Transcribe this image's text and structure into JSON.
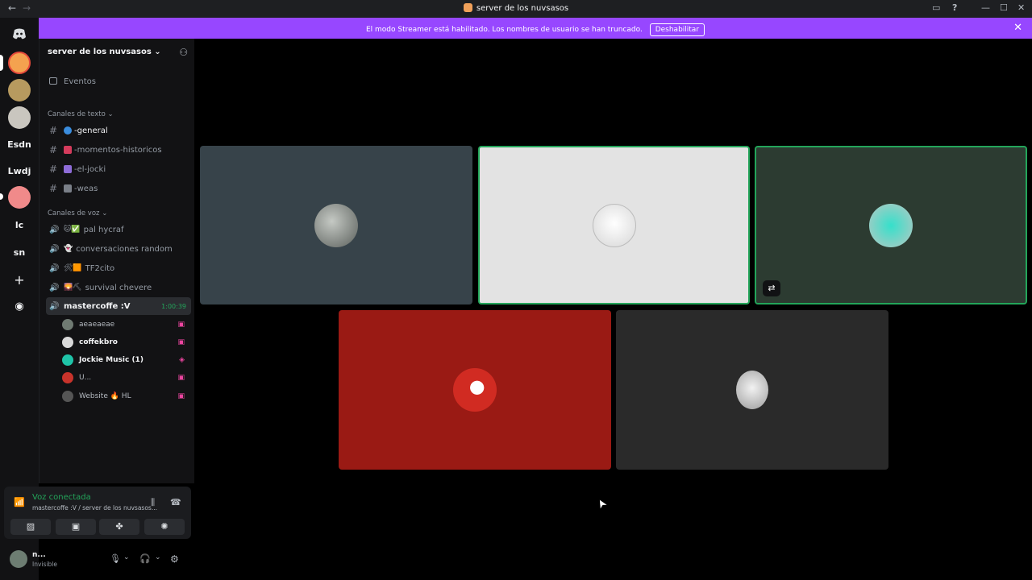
{
  "window": {
    "title": "server de los nuvsasos",
    "back_glyph": "←",
    "forward_glyph": "→",
    "inbox_glyph": "▭",
    "help_glyph": "?",
    "minimize_glyph": "—",
    "maximize_glyph": "☐",
    "close_glyph": "✕"
  },
  "banner": {
    "message": "El modo Streamer está habilitado. Los nombres de usuario se han truncado.",
    "button_label": "Deshabilitar",
    "close_glyph": "✕"
  },
  "server_rail": {
    "items": [
      {
        "name": "discord-home",
        "label": "",
        "icon": "discord-icon"
      },
      {
        "name": "server-1",
        "label": "",
        "icon": "apple-server-icon"
      },
      {
        "name": "server-2",
        "label": "",
        "icon": "dog-server-icon"
      },
      {
        "name": "server-3",
        "label": "",
        "icon": "wolf-server-icon"
      },
      {
        "name": "server-esdn",
        "label": "Esdn"
      },
      {
        "name": "server-lwdj",
        "label": "Lwdj"
      },
      {
        "name": "server-cat",
        "label": "",
        "icon": "cat-server-icon"
      },
      {
        "name": "server-lc",
        "label": "lc"
      },
      {
        "name": "server-sn",
        "label": "sn"
      },
      {
        "name": "add-server",
        "label": "+"
      },
      {
        "name": "discover",
        "label": "◉"
      }
    ]
  },
  "sidebar": {
    "server_name": "server de los nuvsasos",
    "chevron": "⌄",
    "invite_glyph": "⚇",
    "events_label": "Eventos",
    "text_category": "Canales de texto",
    "voice_category": "Canales de voz",
    "hash_glyph": "#",
    "speaker_glyph": "🔊",
    "text_channels": [
      {
        "label": "-general",
        "emoji_color": "#3a8dde",
        "active": true
      },
      {
        "label": "-momentos-historicos",
        "emoji_color": "#d43b5c",
        "active": false
      },
      {
        "label": "-el-jocki",
        "emoji_color": "#8e6cd8",
        "active": false
      },
      {
        "label": "-weas",
        "emoji_color": "#7a7f88",
        "active": false
      }
    ],
    "voice_channels": [
      {
        "label": "pal hycraf",
        "emoji": "🐱✅"
      },
      {
        "label": "conversaciones random",
        "emoji": "👻"
      },
      {
        "label": "TF2cito",
        "emoji": "🛠🟧"
      },
      {
        "label": "survival chevere",
        "emoji": "🌄⛏"
      }
    ],
    "connected_channel": {
      "label": "mastercoffe :V",
      "timer": "1:00:39"
    },
    "members": [
      {
        "name": "aeaeaeae",
        "avatar_color": "#6f7a72",
        "bold": false,
        "live_glyph": "▣"
      },
      {
        "name": "coffekbro",
        "avatar_color": "#d9d9d9",
        "bold": true,
        "live_glyph": "▣"
      },
      {
        "name": "Jockie Music (1)",
        "avatar_color": "#1fc4a8",
        "bold": true,
        "live_glyph": "◈"
      },
      {
        "name": "U...",
        "avatar_color": "#c8332b",
        "bold": false,
        "live_glyph": "▣"
      },
      {
        "name": "Website 🔥 HL",
        "avatar_color": "#555",
        "bold": false,
        "live_glyph": "▣"
      }
    ]
  },
  "voice_panel": {
    "status": "Voz conectada",
    "subtitle": "mastercoffe :V / server de los nuvsasos...",
    "signal_glyph": "📶",
    "noise_glyph": "⫼",
    "disconnect_glyph": "☎",
    "actions": [
      {
        "name": "camera-off-button",
        "glyph": "▨"
      },
      {
        "name": "share-screen-button",
        "glyph": "▣"
      },
      {
        "name": "activities-button",
        "glyph": "✤"
      },
      {
        "name": "soundboard-button",
        "glyph": "✺"
      }
    ]
  },
  "user_panel": {
    "name": "n...",
    "status": "Invisible",
    "mic_glyph": "🎙",
    "headset_glyph": "🎧",
    "chevron": "⌄",
    "settings_glyph": "⚙"
  },
  "stage": {
    "tiles": [
      {
        "name": "participant-tile-1",
        "bg": "#37434a",
        "avatar": "#8a8f8c",
        "speaking": false,
        "badge": ""
      },
      {
        "name": "participant-tile-2",
        "bg": "#e3e3e3",
        "avatar": "#f4f4f4",
        "speaking": true,
        "badge": ""
      },
      {
        "name": "participant-tile-3",
        "bg": "#2c3b31",
        "avatar": "#2fd3c0",
        "speaking": true,
        "badge": "⇄"
      },
      {
        "name": "participant-tile-4",
        "bg": "#9a1a14",
        "avatar": "#d12b22",
        "speaking": false,
        "badge": ""
      },
      {
        "name": "participant-tile-5",
        "bg": "#2a2a2a",
        "avatar": "#e8e8e8",
        "speaking": false,
        "badge": ""
      }
    ],
    "cursor_glyph": "➤"
  }
}
